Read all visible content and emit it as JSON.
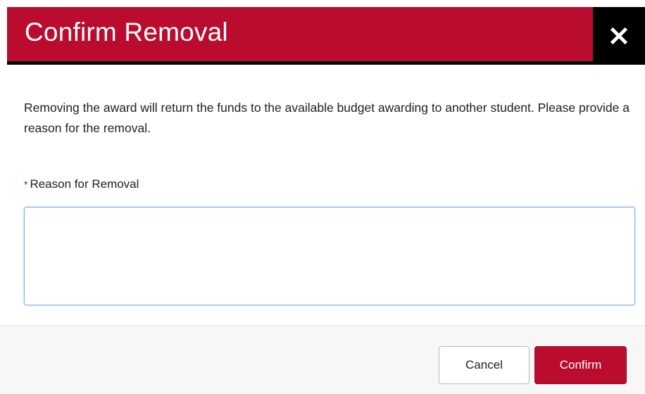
{
  "dialog": {
    "title": "Confirm Removal",
    "close_icon": "close-icon",
    "message": "Removing the award will return the funds to the available budget awarding to another student. Please provide a reason for the removal.",
    "field": {
      "required_marker": "*",
      "label": "Reason for Removal",
      "value": ""
    },
    "footer": {
      "cancel_label": "Cancel",
      "confirm_label": "Confirm"
    }
  },
  "colors": {
    "header_background": "#ba0c2f",
    "header_accent": "#000000",
    "primary_button": "#ba0c2f",
    "input_focus_border": "#7fb2e5",
    "footer_background": "#f7f7f7"
  }
}
